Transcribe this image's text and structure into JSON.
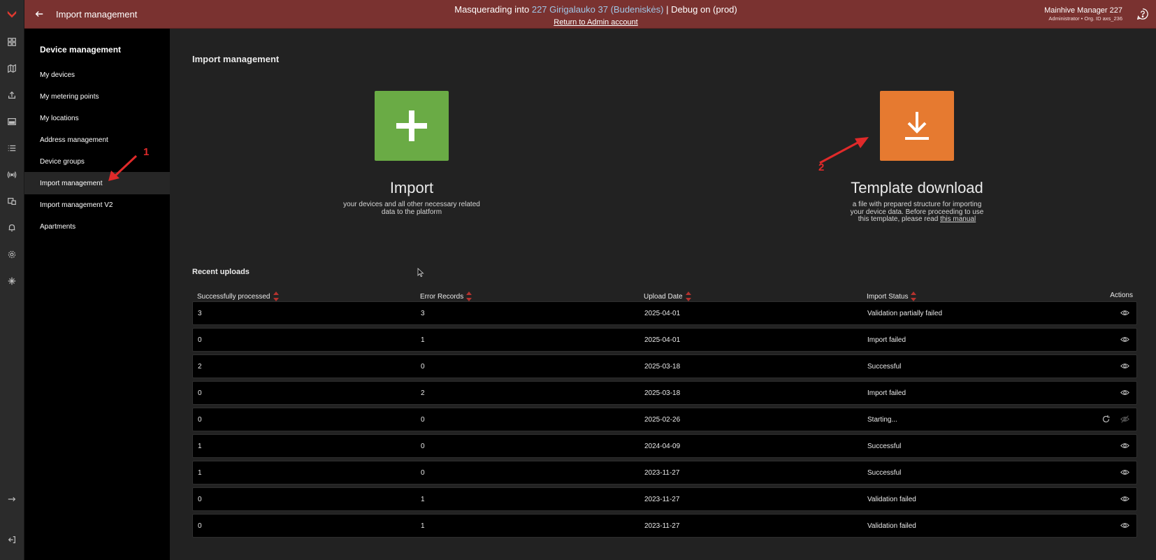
{
  "topbar": {
    "title": "Import management",
    "masq_prefix": "Masquerading into",
    "masq_target": "227 Girigalauko 37 (Budeniskės)",
    "masq_suffix": "| Debug on (prod)",
    "return_link": "Return to Admin account",
    "user_name": "Mainhive Manager 227",
    "user_role": "Administrator • Org. ID axs_236"
  },
  "sidebar": {
    "heading": "Device management",
    "items": [
      {
        "label": "My devices"
      },
      {
        "label": "My metering points"
      },
      {
        "label": "My locations"
      },
      {
        "label": "Address management"
      },
      {
        "label": "Device groups"
      },
      {
        "label": "Import management"
      },
      {
        "label": "Import management V2"
      },
      {
        "label": "Apartments"
      }
    ],
    "active_index": 5
  },
  "main": {
    "title": "Import management",
    "import_card": {
      "title": "Import",
      "desc_line1": "your devices and all other necessary related",
      "desc_line2": "data to the platform"
    },
    "template_card": {
      "title": "Template download",
      "desc_line1": "a file with prepared structure for importing",
      "desc_line2": "your device data. Before proceeding to use",
      "desc_line3": "this template, please read",
      "manual_link": "this manual"
    },
    "annotation_1": "1",
    "annotation_2": "2",
    "recent_title": "Recent uploads",
    "columns": [
      "Successfully processed",
      "Error Records",
      "Upload Date",
      "Import Status",
      "Actions"
    ],
    "rows": [
      {
        "processed": "3",
        "errors": "3",
        "date": "2025-04-01",
        "status": "Validation partially failed",
        "refresh": false
      },
      {
        "processed": "0",
        "errors": "1",
        "date": "2025-04-01",
        "status": "Import failed",
        "refresh": false
      },
      {
        "processed": "2",
        "errors": "0",
        "date": "2025-03-18",
        "status": "Successful",
        "refresh": false
      },
      {
        "processed": "0",
        "errors": "2",
        "date": "2025-03-18",
        "status": "Import failed",
        "refresh": false
      },
      {
        "processed": "0",
        "errors": "0",
        "date": "2025-02-26",
        "status": "Starting...",
        "refresh": true
      },
      {
        "processed": "1",
        "errors": "0",
        "date": "2024-04-09",
        "status": "Successful",
        "refresh": false
      },
      {
        "processed": "1",
        "errors": "0",
        "date": "2023-11-27",
        "status": "Successful",
        "refresh": false
      },
      {
        "processed": "0",
        "errors": "1",
        "date": "2023-11-27",
        "status": "Validation failed",
        "refresh": false
      },
      {
        "processed": "0",
        "errors": "1",
        "date": "2023-11-27",
        "status": "Validation failed",
        "refresh": false
      }
    ]
  },
  "icons": {
    "rail": [
      "logo-icon",
      "dashboard-icon",
      "map-icon",
      "upload-icon",
      "card-icon",
      "list-icon",
      "antenna-icon",
      "devices-icon",
      "bell-icon",
      "gear-icon",
      "integrations-icon",
      "expand-icon",
      "logout-icon"
    ]
  },
  "colors": {
    "topbar": "#7a3230",
    "import_tile": "#6aab45",
    "template_tile": "#e67a30",
    "annotation": "#e02a2a",
    "sort_arrow": "#b5322e"
  }
}
